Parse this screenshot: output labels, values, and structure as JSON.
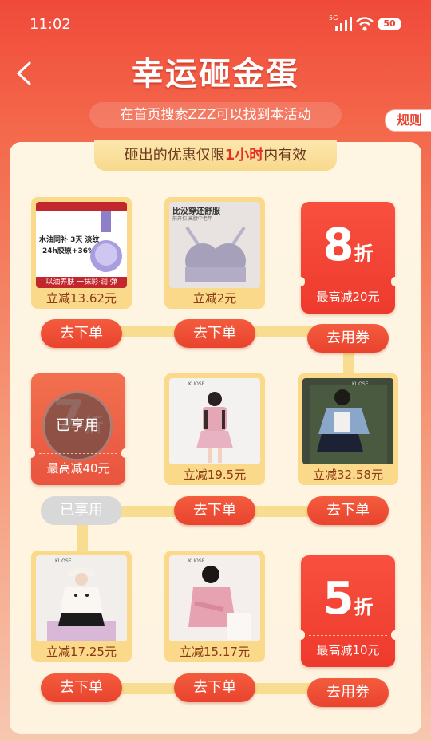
{
  "status_bar": {
    "time": "11:02",
    "network": "5G",
    "battery": "50"
  },
  "header": {
    "title": "幸运砸金蛋",
    "subtitle": "在首页搜索ZZZ可以找到本活动",
    "rules": "规则"
  },
  "notice": {
    "prefix": "砸出的优惠仅限",
    "highlight": "1小时",
    "suffix": "内有效"
  },
  "products": [
    {
      "saving": "立减13.62元",
      "button": "去下单",
      "tag_text": "水油同补 3天 淡纹",
      "tag_text2": "24h胶原+36%",
      "footer": "以油养肤 一抹彩·润·弹"
    },
    {
      "saving": "立减2元",
      "button": "去下单",
      "tag_text": "比没穿还舒服",
      "tag_text2": "前开扣 高腰中老年"
    },
    {
      "saving": "立减19.5元",
      "button": "去下单",
      "brand": "KUOSE"
    },
    {
      "saving": "立减32.58元",
      "button": "去下单",
      "brand": "KUOSE"
    },
    {
      "saving": "立减17.25元",
      "button": "去下单",
      "brand": "KUOSE"
    },
    {
      "saving": "立减15.17元",
      "button": "去下单",
      "brand": "KUOSE"
    }
  ],
  "coupons": [
    {
      "value": "8",
      "unit": "折",
      "max": "最高减20元",
      "button": "去用券"
    },
    {
      "value": "7",
      "unit": "折",
      "max": "最高减40元",
      "button": "已享用",
      "stamp": "已享用"
    },
    {
      "value": "5",
      "unit": "折",
      "max": "最高减10元",
      "button": "去用券"
    }
  ],
  "colors": {
    "brand_red": "#e9432e",
    "panel_bg": "#fdf3df",
    "card_gold": "#fbd98a"
  }
}
